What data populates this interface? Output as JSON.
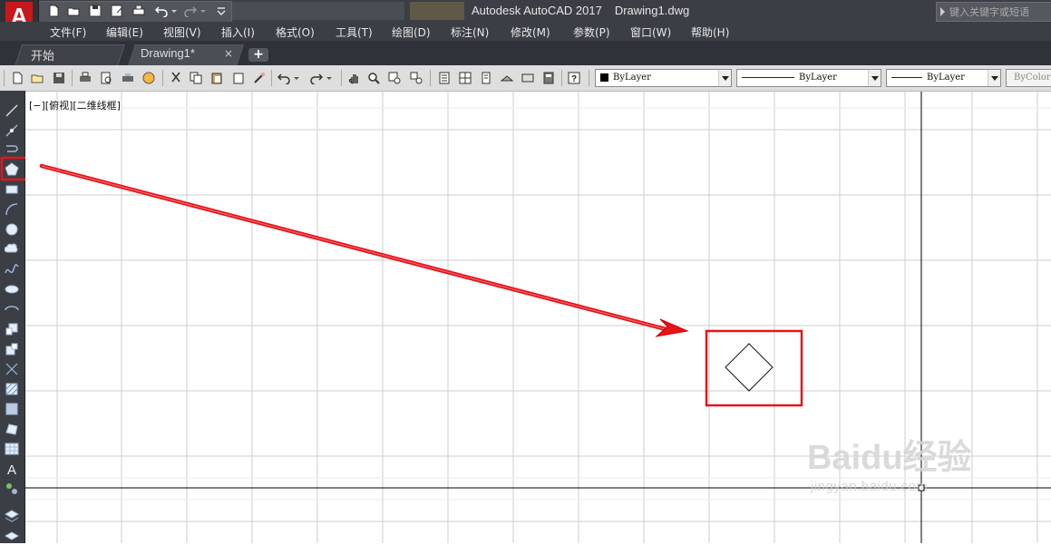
{
  "app": {
    "title": "Autodesk AutoCAD 2017",
    "filename": "Drawing1.dwg",
    "logo_letter": "A"
  },
  "search": {
    "placeholder": "键入关键字或短语"
  },
  "menu": [
    "文件(F)",
    "编辑(E)",
    "视图(V)",
    "插入(I)",
    "格式(O)",
    "工具(T)",
    "绘图(D)",
    "标注(N)",
    "修改(M)",
    "参数(P)",
    "窗口(W)",
    "帮助(H)"
  ],
  "tabs": {
    "start": "开始",
    "drawing": "Drawing1*",
    "close": "×",
    "new": "+"
  },
  "properties": {
    "color": "ByLayer",
    "linetype": "ByLayer",
    "lineweight": "ByLayer",
    "plotstyle": "ByColor"
  },
  "viewport": {
    "label": "[−][俯视][二维线框]"
  },
  "watermark": {
    "brand": "Baidu经验",
    "url": "jingyan.baidu.com"
  },
  "colors": {
    "accent_red": "#e8141b",
    "logo_red": "#c8181e",
    "titlebar": "#3b3f45",
    "grid": "#cfcfcf"
  },
  "icons": {
    "left_toolbar": [
      "line-icon",
      "construction-line-icon",
      "polyline-icon",
      "polygon-icon",
      "rectangle-icon",
      "arc-icon",
      "circle-icon",
      "revision-cloud-icon",
      "spline-icon",
      "ellipse-icon",
      "ellipse-arc-icon",
      "insert-block-icon",
      "make-block-icon",
      "point-icon",
      "hatch-icon",
      "gradient-icon",
      "region-icon",
      "table-icon",
      "multiline-text-icon",
      "add-selected-icon",
      "layers-icon"
    ],
    "highlighted_tool": "polygon-icon"
  }
}
